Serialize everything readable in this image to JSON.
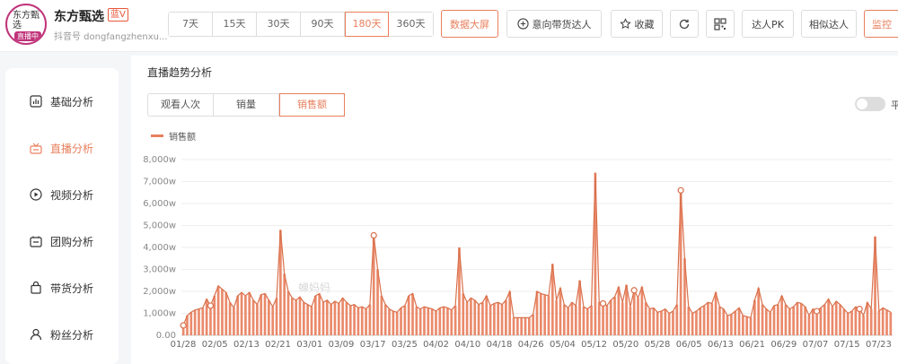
{
  "account": {
    "name": "东方甄选",
    "tag": "蓝V",
    "id_text": "抖音号 dongfangzhenxu...",
    "avatar_text": "东方甄选",
    "live_badge": "直播中"
  },
  "ranges": [
    "7天",
    "15天",
    "30天",
    "90天",
    "180天",
    "360天"
  ],
  "active_range": "180天",
  "toolbar": {
    "dashboard": "数据大屏",
    "intent": "意向带货达人",
    "favorite": "收藏",
    "pk": "达人PK",
    "similar": "相似达人",
    "monitor": "监控"
  },
  "sidebar": {
    "items": [
      {
        "label": "基础分析",
        "icon": "bar-chart-icon"
      },
      {
        "label": "直播分析",
        "icon": "live-icon"
      },
      {
        "label": "视频分析",
        "icon": "play-icon"
      },
      {
        "label": "团购分析",
        "icon": "coupon-icon"
      },
      {
        "label": "带货分析",
        "icon": "bag-icon"
      },
      {
        "label": "粉丝分析",
        "icon": "user-icon"
      }
    ],
    "active": "直播分析"
  },
  "section_title": "直播趋势分析",
  "metric_tabs": [
    "观看人次",
    "销量",
    "销售额"
  ],
  "active_metric": "销售额",
  "toggle_label": "平",
  "watermark": "蝉妈妈",
  "chart_data": {
    "type": "bar",
    "color": "#e8805e",
    "series": [
      {
        "name": "销售额"
      }
    ],
    "yunit": "w",
    "ylim": [
      0,
      8000
    ],
    "yticks": [
      "0.00",
      "1,000w",
      "2,000w",
      "3,000w",
      "4,000w",
      "5,000w",
      "6,000w",
      "7,000w",
      "8,000w"
    ],
    "xticks": [
      "01/28",
      "02/05",
      "02/13",
      "02/21",
      "03/01",
      "03/09",
      "03/17",
      "03/25",
      "04/02",
      "04/10",
      "04/18",
      "04/26",
      "05/04",
      "05/12",
      "05/20",
      "05/28",
      "06/05",
      "06/13",
      "06/21",
      "06/29",
      "07/07",
      "07/15",
      "07/23"
    ],
    "values": [
      450,
      900,
      1050,
      1150,
      1200,
      1250,
      1650,
      1350,
      1800,
      2250,
      2100,
      1950,
      1500,
      1250,
      1800,
      1950,
      1800,
      1950,
      1600,
      1400,
      1850,
      1900,
      1600,
      1300,
      1700,
      4800,
      2800,
      2000,
      1700,
      1600,
      1750,
      1500,
      1400,
      1300,
      1800,
      1900,
      1500,
      1600,
      1400,
      1550,
      1450,
      1700,
      1500,
      1350,
      1400,
      1250,
      1300,
      1200,
      1400,
      4550,
      3000,
      1800,
      1400,
      1200,
      1100,
      1050,
      1250,
      1350,
      1800,
      1900,
      1300,
      1200,
      1300,
      1250,
      1200,
      1100,
      1250,
      1300,
      1250,
      1150,
      1350,
      4000,
      1900,
      1500,
      1700,
      1600,
      1400,
      1500,
      1800,
      1350,
      1450,
      1500,
      1400,
      1600,
      2000,
      800,
      800,
      800,
      800,
      800,
      950,
      2000,
      1900,
      1850,
      1800,
      3250,
      1600,
      2150,
      1400,
      1250,
      1500,
      1350,
      2500,
      1300,
      1200,
      1350,
      7400,
      1500,
      1450,
      1350,
      1600,
      1750,
      2200,
      1500,
      2300,
      1300,
      2050,
      1700,
      2200,
      1500,
      1200,
      1250,
      1050,
      1100,
      1200,
      1000,
      1100,
      1400,
      6600,
      3500,
      1300,
      1000,
      1100,
      1250,
      1350,
      1500,
      1450,
      1950,
      1300,
      1200,
      900,
      950,
      1100,
      1250,
      900,
      850,
      800,
      1600,
      2150,
      1400,
      1200,
      1050,
      1350,
      1400,
      1800,
      1400,
      1200,
      1300,
      1500,
      1450,
      1300,
      900,
      1200,
      1100,
      1250,
      1400,
      1650,
      1300,
      1550,
      1400,
      1200,
      1000,
      1100,
      1300,
      1200,
      900,
      1500,
      1200,
      4500,
      1100,
      1250,
      1150,
      1050
    ],
    "markers": [
      0,
      7,
      49,
      108,
      116,
      128,
      163,
      174
    ]
  }
}
